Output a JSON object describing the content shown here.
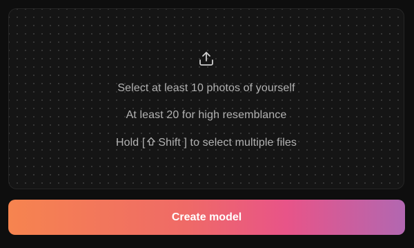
{
  "dropzone": {
    "icon": "upload-icon",
    "line1": "Select at least 10 photos of yourself",
    "line2": "At least 20 for high resemblance",
    "line3_prefix": "Hold [",
    "line3_shift_icon": "shift-key-icon",
    "line3_shift_label": "Shift",
    "line3_suffix": "] to select multiple files"
  },
  "action": {
    "create_label": "Create model"
  },
  "colors": {
    "background": "#0e0e0e",
    "dropzone_background": "#151515",
    "text_muted": "#b3b3b3",
    "gradient_start": "#f6844f",
    "gradient_mid": "#e85488",
    "gradient_end": "#b267b1"
  }
}
